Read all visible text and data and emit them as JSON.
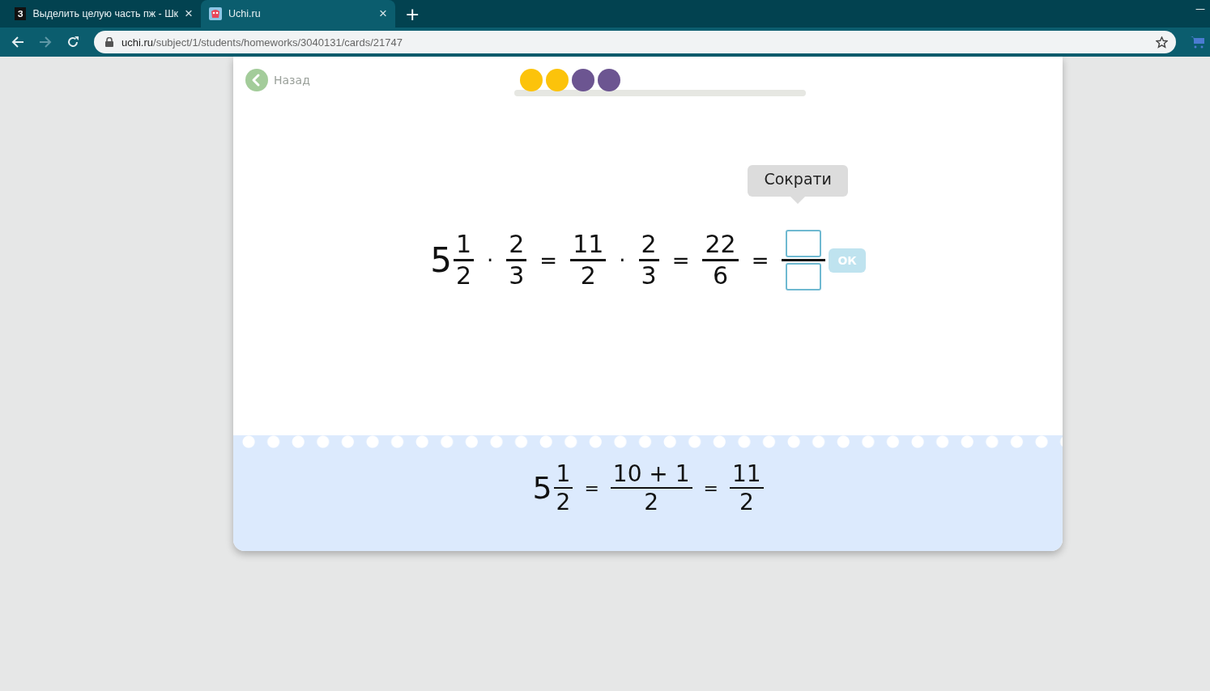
{
  "browser": {
    "tabs": [
      {
        "favicon": "З",
        "title": "Выделить целую часть пж - Шк",
        "selected": false,
        "close": "×"
      },
      {
        "title": "Uchi.ru",
        "selected": true,
        "close": "×"
      }
    ],
    "new_tab": "+",
    "minimize": "—",
    "address": {
      "domain": "uchi.ru",
      "path": "/subject/1/students/homeworks/3040131/cards/21747"
    }
  },
  "card": {
    "back_label": "Назад",
    "progress_dots": [
      {
        "color": "#fcc30b"
      },
      {
        "color": "#fcc30b"
      },
      {
        "color": "#6c5591"
      },
      {
        "color": "#6c5591"
      }
    ],
    "tooltip": "Сократи",
    "expression": [
      {
        "kind": "mixed",
        "whole": "5",
        "num": "1",
        "den": "2"
      },
      {
        "kind": "op",
        "text": "·"
      },
      {
        "kind": "frac",
        "num": "2",
        "den": "3"
      },
      {
        "kind": "op",
        "text": "="
      },
      {
        "kind": "frac",
        "num": "11",
        "den": "2"
      },
      {
        "kind": "op",
        "text": "·"
      },
      {
        "kind": "frac",
        "num": "2",
        "den": "3"
      },
      {
        "kind": "op",
        "text": "="
      },
      {
        "kind": "frac",
        "num": "22",
        "den": "6"
      },
      {
        "kind": "op",
        "text": "="
      },
      {
        "kind": "answer"
      }
    ],
    "ok_button": {
      "label": "ОК",
      "disabled": true
    },
    "hint": [
      {
        "kind": "mixed",
        "whole": "5",
        "num": "1",
        "den": "2"
      },
      {
        "kind": "op",
        "text": "="
      },
      {
        "kind": "frac",
        "num": "10 + 1",
        "den": "2"
      },
      {
        "kind": "op",
        "text": "="
      },
      {
        "kind": "frac",
        "num": "11",
        "den": "2"
      }
    ]
  }
}
